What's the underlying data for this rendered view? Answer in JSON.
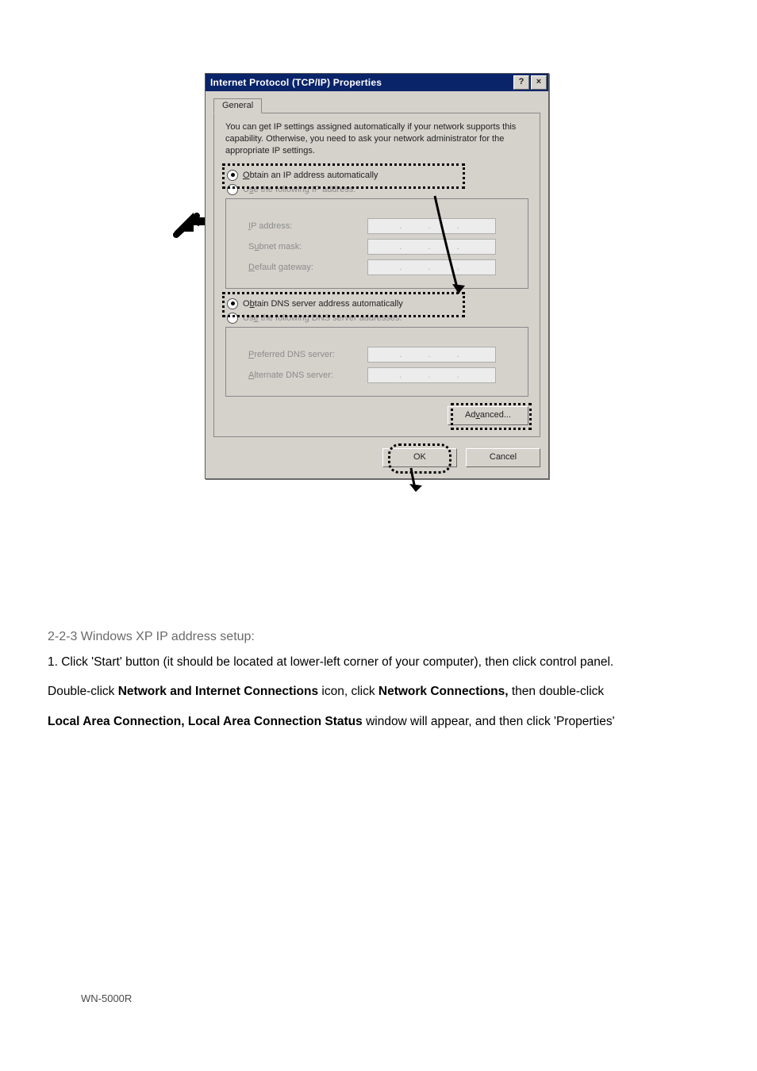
{
  "dialog": {
    "title": "Internet Protocol (TCP/IP) Properties",
    "help_btn": "?",
    "close_btn": "×",
    "tab_label": "General",
    "description": "You can get IP settings assigned automatically if your network supports this capability. Otherwise, you need to ask your network administrator for the appropriate IP settings.",
    "ip_group": {
      "radio_auto": "Obtain an IP address automatically",
      "radio_manual": "Use the following IP address:",
      "ip_label": "IP address:",
      "subnet_label": "Subnet mask:",
      "gateway_label": "Default gateway:"
    },
    "dns_group": {
      "radio_auto": "Obtain DNS server address automatically",
      "radio_manual": "Use the following DNS server addresses:",
      "pref_label": "Preferred DNS server:",
      "alt_label": "Alternate DNS server:"
    },
    "advanced_btn": "Advanced...",
    "ok_btn": "OK",
    "cancel_btn": "Cancel"
  },
  "instructions": {
    "heading": "2-2-3 Windows XP IP address setup:",
    "line1_a": "1. Click 'Start' button (it should be located at lower-left corner of your computer), then click control panel.",
    "line2_a": "Double-click",
    "line2_b_bold": "Network and Internet Connections",
    "line2_c": "icon, click",
    "line2_d_bold": "Network Connections,",
    "line2_e": "then double-click",
    "line3_a_bold": "Local Area Connection, Local Area Connection Status",
    "line3_b": "window will appear, and then click 'Properties'"
  },
  "footer": {
    "model": "WN-5000R"
  }
}
